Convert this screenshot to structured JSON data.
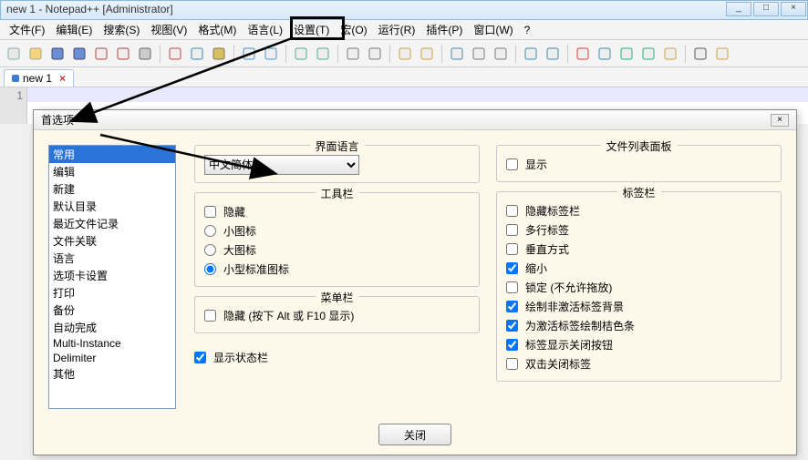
{
  "window": {
    "title": "new  1 - Notepad++ [Administrator]",
    "min": "_",
    "max": "□",
    "close": "×"
  },
  "menubar": [
    "文件(F)",
    "编辑(E)",
    "搜索(S)",
    "视图(V)",
    "格式(M)",
    "语言(L)",
    "设置(T)",
    "宏(O)",
    "运行(R)",
    "插件(P)",
    "窗口(W)",
    "?"
  ],
  "tabs": {
    "name": "new  1",
    "close": "×"
  },
  "gutter": {
    "line1": "1"
  },
  "dialog": {
    "title": "首选项",
    "close": "×",
    "close_btn": "关闭",
    "categories": [
      "常用",
      "编辑",
      "新建",
      "默认目录",
      "最近文件记录",
      "文件关联",
      "语言",
      "选项卡设置",
      "打印",
      "备份",
      "自动完成",
      "Multi-Instance",
      "Delimiter",
      "其他"
    ],
    "lang_group": "界面语言",
    "lang_value": "中文简体",
    "toolbar_group": {
      "title": "工具栏",
      "hide": "隐藏",
      "small_icons": "小图标",
      "big_icons": "大图标",
      "std_icons": "小型标准图标"
    },
    "menubar_group": {
      "title": "菜单栏",
      "hide": "隐藏 (按下 Alt 或 F10 显示)"
    },
    "status_show": "显示状态栏",
    "doclist_group": {
      "title": "文件列表面板",
      "show": "显示"
    },
    "tabbar_group": {
      "title": "标签栏",
      "hide": "隐藏标签栏",
      "multi": "多行标签",
      "vert": "垂直方式",
      "shrink": "缩小",
      "lock": "锁定 (不允许拖放)",
      "inactive_bg": "绘制非激活标签背景",
      "active_bar": "为激活标签绘制桔色条",
      "show_close": "标签显示关闭按钮",
      "dbl_close": "双击关闭标签"
    }
  },
  "toolbar_icons": [
    {
      "name": "new-file-icon",
      "color": "#e8e8e8",
      "fg": "#8aa"
    },
    {
      "name": "open-file-icon",
      "color": "#f4d47c",
      "fg": "#aa8"
    },
    {
      "name": "save-icon",
      "color": "#6a8fd8",
      "fg": "#446"
    },
    {
      "name": "save-all-icon",
      "color": "#6a8fd8",
      "fg": "#446"
    },
    {
      "name": "close-icon",
      "color": "#eee",
      "fg": "#a44"
    },
    {
      "name": "close-all-icon",
      "color": "#eee",
      "fg": "#a44"
    },
    {
      "name": "print-icon",
      "color": "#ccc",
      "fg": "#666"
    },
    {
      "name": "sep"
    },
    {
      "name": "cut-icon",
      "color": "#eee",
      "fg": "#b44"
    },
    {
      "name": "copy-icon",
      "color": "#eee",
      "fg": "#48a"
    },
    {
      "name": "paste-icon",
      "color": "#d8c060",
      "fg": "#775"
    },
    {
      "name": "sep"
    },
    {
      "name": "undo-icon",
      "color": "#eee",
      "fg": "#4793c8"
    },
    {
      "name": "redo-icon",
      "color": "#eee",
      "fg": "#4793c8"
    },
    {
      "name": "sep"
    },
    {
      "name": "find-icon",
      "color": "#eee",
      "fg": "#5a8"
    },
    {
      "name": "replace-icon",
      "color": "#eee",
      "fg": "#5a8"
    },
    {
      "name": "sep"
    },
    {
      "name": "zoom-in-icon",
      "color": "#eee",
      "fg": "#777"
    },
    {
      "name": "zoom-out-icon",
      "color": "#eee",
      "fg": "#777"
    },
    {
      "name": "sep"
    },
    {
      "name": "sync-v-icon",
      "color": "#eee",
      "fg": "#c8a048"
    },
    {
      "name": "sync-h-icon",
      "color": "#eee",
      "fg": "#c8a048"
    },
    {
      "name": "sep"
    },
    {
      "name": "wrap-icon",
      "color": "#eee",
      "fg": "#48a"
    },
    {
      "name": "all-chars-icon",
      "color": "#eee",
      "fg": "#777"
    },
    {
      "name": "indent-guide-icon",
      "color": "#eee",
      "fg": "#777"
    },
    {
      "name": "sep"
    },
    {
      "name": "func-list-icon",
      "color": "#eee",
      "fg": "#48a"
    },
    {
      "name": "doc-map-icon",
      "color": "#eee",
      "fg": "#48a"
    },
    {
      "name": "sep"
    },
    {
      "name": "record-macro-icon",
      "color": "#eee",
      "fg": "#c44"
    },
    {
      "name": "stop-macro-icon",
      "color": "#eee",
      "fg": "#48a"
    },
    {
      "name": "play-macro-icon",
      "color": "#eee",
      "fg": "#3a7"
    },
    {
      "name": "play-multi-icon",
      "color": "#eee",
      "fg": "#3a7"
    },
    {
      "name": "save-macro-icon",
      "color": "#eee",
      "fg": "#c8a048"
    },
    {
      "name": "sep"
    },
    {
      "name": "spell-icon",
      "color": "#eee",
      "fg": "#555"
    },
    {
      "name": "spell2-icon",
      "color": "#eee",
      "fg": "#c8a048"
    }
  ]
}
